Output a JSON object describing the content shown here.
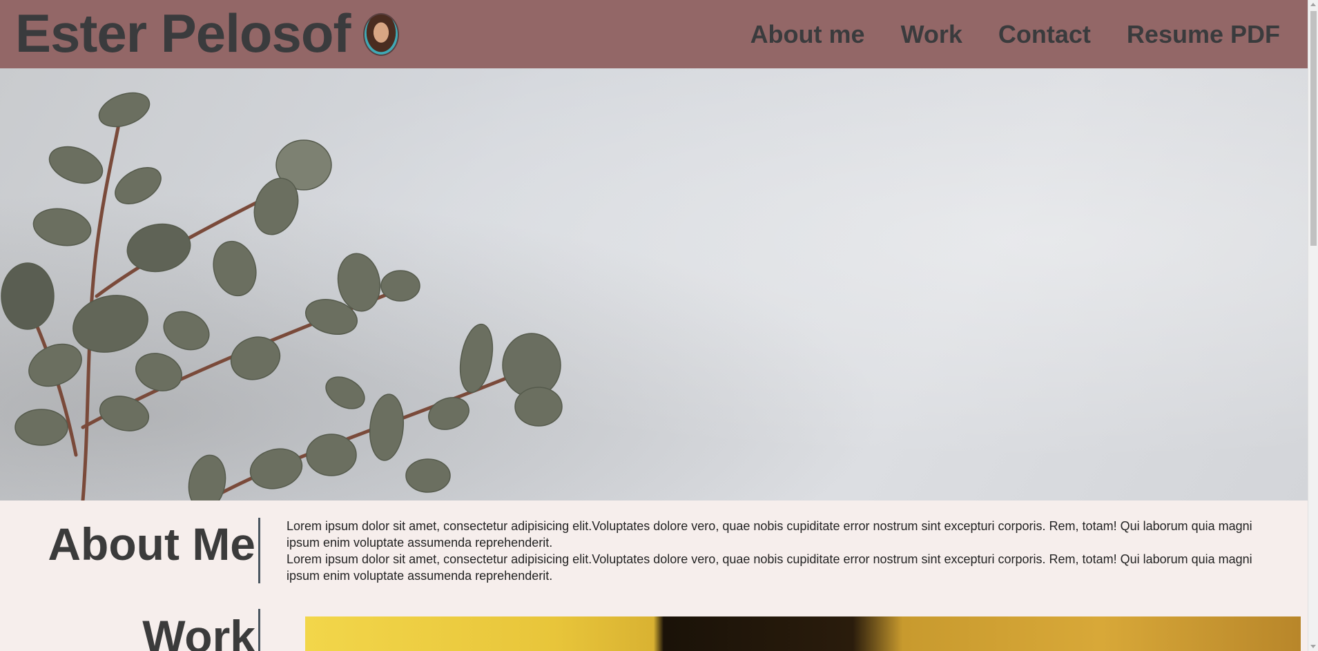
{
  "header": {
    "brand_name": "Ester Pelosof",
    "avatar_alt": "Profile photo",
    "nav": [
      {
        "label": "About me"
      },
      {
        "label": "Work"
      },
      {
        "label": "Contact"
      },
      {
        "label": "Resume PDF"
      }
    ],
    "background_color": "#936767"
  },
  "hero": {
    "image_description": "Eucalyptus branches on grey concrete background",
    "icon": "eucalyptus-image"
  },
  "about": {
    "title": "About Me",
    "paragraphs": [
      "Lorem ipsum dolor sit amet, consectetur adipisicing elit.Voluptates dolore vero, quae nobis cupiditate error nostrum sint excepturi corporis. Rem, totam! Qui laborum quia magni ipsum enim voluptate assumenda reprehenderit.",
      "Lorem ipsum dolor sit amet, consectetur adipisicing elit.Voluptates dolore vero, quae nobis cupiditate error nostrum sint excepturi corporis. Rem, totam! Qui laborum quia magni ipsum enim voluptate assumenda reprehenderit."
    ]
  },
  "work": {
    "title": "Work"
  },
  "colors": {
    "page_background": "#f6eeec",
    "text": "#3b3b3b",
    "divider": "#4a5660"
  }
}
